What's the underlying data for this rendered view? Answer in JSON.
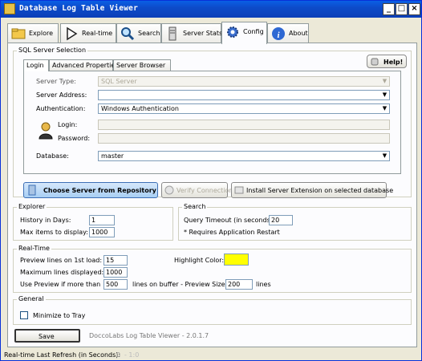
{
  "window": {
    "title": "Database Log Table Viewer",
    "controls": [
      "_",
      "□",
      "×"
    ]
  },
  "main_tabs": [
    {
      "label": "Explore",
      "icon": "folder-icon"
    },
    {
      "label": "Real-time",
      "icon": "play-icon"
    },
    {
      "label": "Search",
      "icon": "magnifier-icon"
    },
    {
      "label": "Server Stats",
      "icon": "server-icon"
    },
    {
      "label": "Config",
      "icon": "gear-icon"
    },
    {
      "label": "About",
      "icon": "info-icon"
    }
  ],
  "active_main_tab": "Config",
  "sql_server": {
    "group_title": "SQL Server Selection",
    "subtabs": [
      "Login",
      "Advanced Properties",
      "Server Browser"
    ],
    "active_subtab": "Login",
    "help_label": "Help!",
    "server_type_label": "Server Type:",
    "server_type_value": "SQL Server",
    "server_address_label": "Server Address:",
    "server_address_value": "",
    "authentication_label": "Authentication:",
    "authentication_value": "Windows Authentication",
    "login_label": "Login:",
    "login_value": "",
    "password_label": "Password:",
    "password_value": "",
    "database_label": "Database:",
    "database_value": "master",
    "choose_server_button": "Choose Server from Repository",
    "verify_button": "Verify Connection",
    "install_extension_button": "Install Server Extension on selected database"
  },
  "explorer": {
    "title": "Explorer",
    "history_label": "History in Days:",
    "history_value": "1",
    "max_items_label": "Max items to display:",
    "max_items_value": "1000"
  },
  "search": {
    "title": "Search",
    "query_timeout_label": "Query Timeout (in seconds):",
    "query_timeout_value": "20",
    "note": "* Requires Application Restart"
  },
  "realtime": {
    "title": "Real-Time",
    "preview_lines_label": "Preview lines on 1st load:",
    "preview_lines_value": "15",
    "max_lines_label": "Maximum lines displayed:",
    "max_lines_value": "1000",
    "use_preview_label": "Use Preview if more than",
    "use_preview_value": "500",
    "lines_on_buffer_label": "lines on buffer  - Preview Size:",
    "preview_size_value": "200",
    "lines_label": "lines",
    "highlight_label": "Highlight Color:",
    "highlight_color": "#FFFF00"
  },
  "general": {
    "title": "General",
    "minimize_label": "Minimize to Tray",
    "minimize_checked": false
  },
  "save_label": "Save",
  "version_text": "DoccoLabs Log Table Viewer - 2.0.1.7",
  "status": {
    "label": "Real-time Last Refresh (in Seconds):",
    "value": "0",
    "extra": "- 1:0"
  }
}
